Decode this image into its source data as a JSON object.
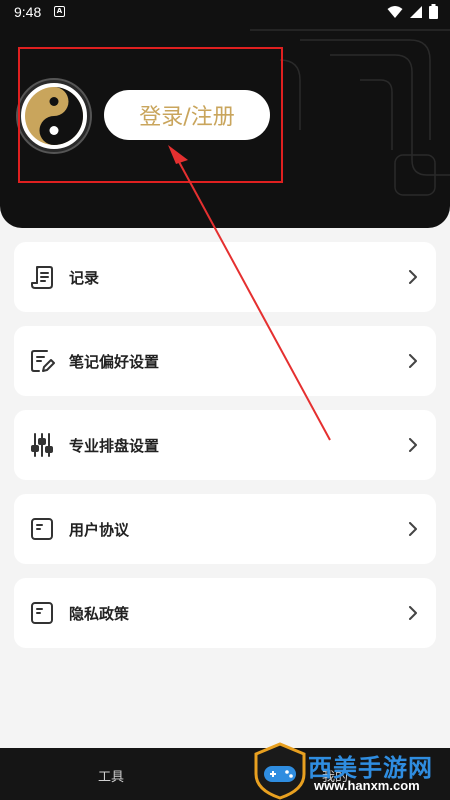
{
  "status_bar": {
    "time": "9:48",
    "notification_glyph": "A"
  },
  "profile": {
    "login_label": "登录/注册",
    "avatar_icon": "yin-yang-icon"
  },
  "menu": {
    "items": [
      {
        "label": "记录",
        "icon": "record-list-icon"
      },
      {
        "label": "笔记偏好设置",
        "icon": "note-edit-icon"
      },
      {
        "label": "专业排盘设置",
        "icon": "sliders-icon"
      },
      {
        "label": "用户协议",
        "icon": "document-icon"
      },
      {
        "label": "隐私政策",
        "icon": "document-icon"
      }
    ]
  },
  "bottom_nav": {
    "tools_label": "工具",
    "mine_label": "我的"
  },
  "watermark": {
    "title": "西美手游网",
    "url": "www.hanxm.com"
  },
  "colors": {
    "header_bg": "#111111",
    "login_text": "#c9a55c",
    "highlight": "#e02020",
    "page_bg": "#f4f4f4"
  }
}
